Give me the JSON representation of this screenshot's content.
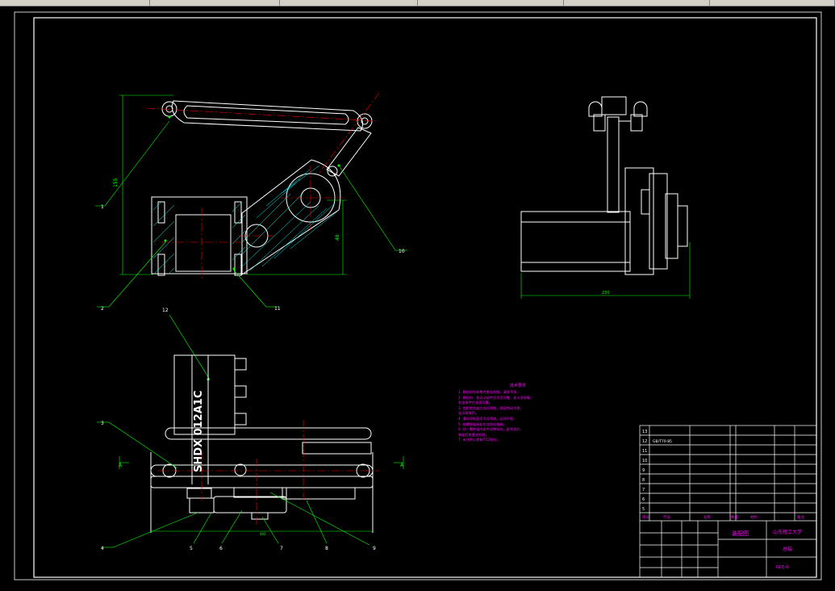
{
  "toolbar": {
    "segments": 6
  },
  "drawing": {
    "line_color": "#ffffff",
    "dim_color": "#00ff00",
    "center_color": "#ff0000",
    "hatch_color": "#00ffff",
    "annotation_color": "#ff00ff",
    "frame_color": "#ffffff"
  },
  "callouts": {
    "top_view": [
      "1",
      "2",
      "10",
      "11",
      "12"
    ],
    "front_view": [
      "3",
      "4",
      "5",
      "6",
      "7",
      "8",
      "9"
    ]
  },
  "dims": {
    "top_left_vertical": "155",
    "top_right_vertical": "48",
    "side_bottom": "230",
    "front_bottom": "460"
  },
  "side_labels": {
    "left_marker": "A",
    "right_marker": "A"
  },
  "part_label_text": "SHDX 012A1C",
  "notes": {
    "title": "技术要求",
    "lines": [
      "1. 装配前所有零件需去毛刺，清洗干净。",
      "2. 装配时，各运动部件应灵活可靠，无卡滞现象。",
      "   各连接件应紧固可靠。",
      "3. 齿轮啮合处应加润滑脂，保证传动平稳，",
      "   无异常噪声。",
      "4. 滑动导轨面须涂润滑油，运动平稳。",
      "5. 各螺纹连接处应加防松措施。",
      "6. 同一零件组内各件间隙均匀，配合良好，",
      "   装配后按要求检验。",
      "7. 未注明公差按IT12执行。"
    ]
  },
  "title_block": {
    "school": "山东理工大学",
    "drawing_title": "装配图",
    "title_right": "总装",
    "drawing_no": "GLYJ-0",
    "rows": [
      "13",
      "12",
      "11",
      "10",
      "9",
      "8",
      "7",
      "6",
      "5",
      "4",
      "3",
      "2",
      "1"
    ],
    "std_part": "GB/T70-85",
    "header_cells": [
      "序号",
      "代号",
      "名称",
      "数量",
      "材料",
      "备注"
    ]
  }
}
